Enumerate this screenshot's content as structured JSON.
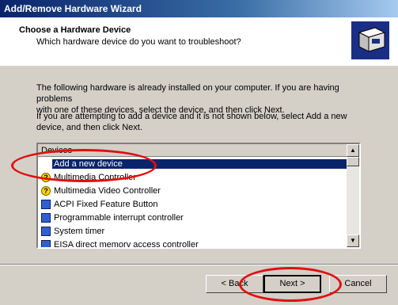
{
  "window": {
    "title": "Add/Remove Hardware Wizard"
  },
  "header": {
    "title": "Choose a Hardware Device",
    "subtitle": "Which hardware device do you want to troubleshoot?"
  },
  "body": {
    "paragraph1_line1": "The following hardware is already installed on your computer. If you are having problems",
    "paragraph1_line2": "with one of these devices, select the device, and then click Next.",
    "paragraph2_line1": "If you are attempting to add a device and it is not shown below, select Add a new",
    "paragraph2_line2": "device, and then click Next."
  },
  "list": {
    "column_header": "Devices",
    "items": [
      {
        "label": "Add a new device",
        "icon": "none",
        "selected": true
      },
      {
        "label": "Multimedia Controller",
        "icon": "question-device-icon"
      },
      {
        "label": "Multimedia Video Controller",
        "icon": "question-device-icon"
      },
      {
        "label": "ACPI Fixed Feature Button",
        "icon": "computer-icon"
      },
      {
        "label": "Programmable interrupt controller",
        "icon": "computer-icon"
      },
      {
        "label": "System timer",
        "icon": "computer-icon"
      },
      {
        "label": "EISA direct memory access controller",
        "icon": "computer-icon"
      }
    ]
  },
  "buttons": {
    "back": "< Back",
    "next": "Next >",
    "cancel": "Cancel"
  },
  "colors": {
    "annotation_circle": "#e01010",
    "selection": "#0a246a",
    "titlebar": "#0a246a"
  }
}
